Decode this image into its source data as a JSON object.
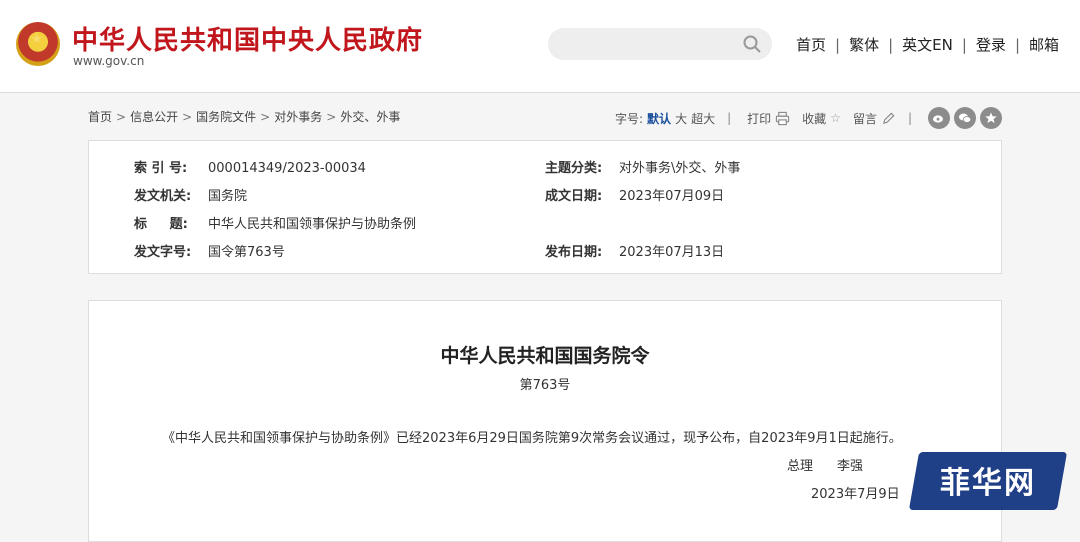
{
  "header": {
    "title": "中华人民共和国中央人民政府",
    "domain": "www.gov.cn",
    "search_placeholder": "",
    "nav": [
      "首页",
      "繁体",
      "英文EN",
      "登录",
      "邮箱"
    ],
    "nav_separator": "|"
  },
  "breadcrumb": {
    "items": [
      "首页",
      "信息公开",
      "国务院文件",
      "对外事务",
      "外交、外事"
    ],
    "separator": ">"
  },
  "tools": {
    "font_label": "字号:",
    "font_default": "默认",
    "font_large": "大",
    "font_xlarge": "超大",
    "print": "打印",
    "favorite": "收藏",
    "comment": "留言",
    "separator": "|"
  },
  "meta": {
    "index_label": "索 引 号:",
    "index_value": "000014349/2023-00034",
    "topic_label": "主题分类:",
    "topic_value": "对外事务\\外交、外事",
    "issuer_label": "发文机关:",
    "issuer_value": "国务院",
    "written_label": "成文日期:",
    "written_value": "2023年07月09日",
    "title_label": "标     题:",
    "title_value": "中华人民共和国领事保护与协助条例",
    "docno_label": "发文字号:",
    "docno_value": "国令第763号",
    "published_label": "发布日期:",
    "published_value": "2023年07月13日"
  },
  "article": {
    "title": "中华人民共和国国务院令",
    "number": "第763号",
    "body": "《中华人民共和国领事保护与协助条例》已经2023年6月29日国务院第9次常务会议通过，现予公布，自2023年9月1日起施行。",
    "signer_role": "总理",
    "signer_name": "李强",
    "date": "2023年7月9日"
  },
  "watermark": {
    "text": "菲华网"
  },
  "colors": {
    "brand_red": "#c0161c",
    "link_blue": "#1a4f9c",
    "watermark_blue": "#1f3f86"
  }
}
